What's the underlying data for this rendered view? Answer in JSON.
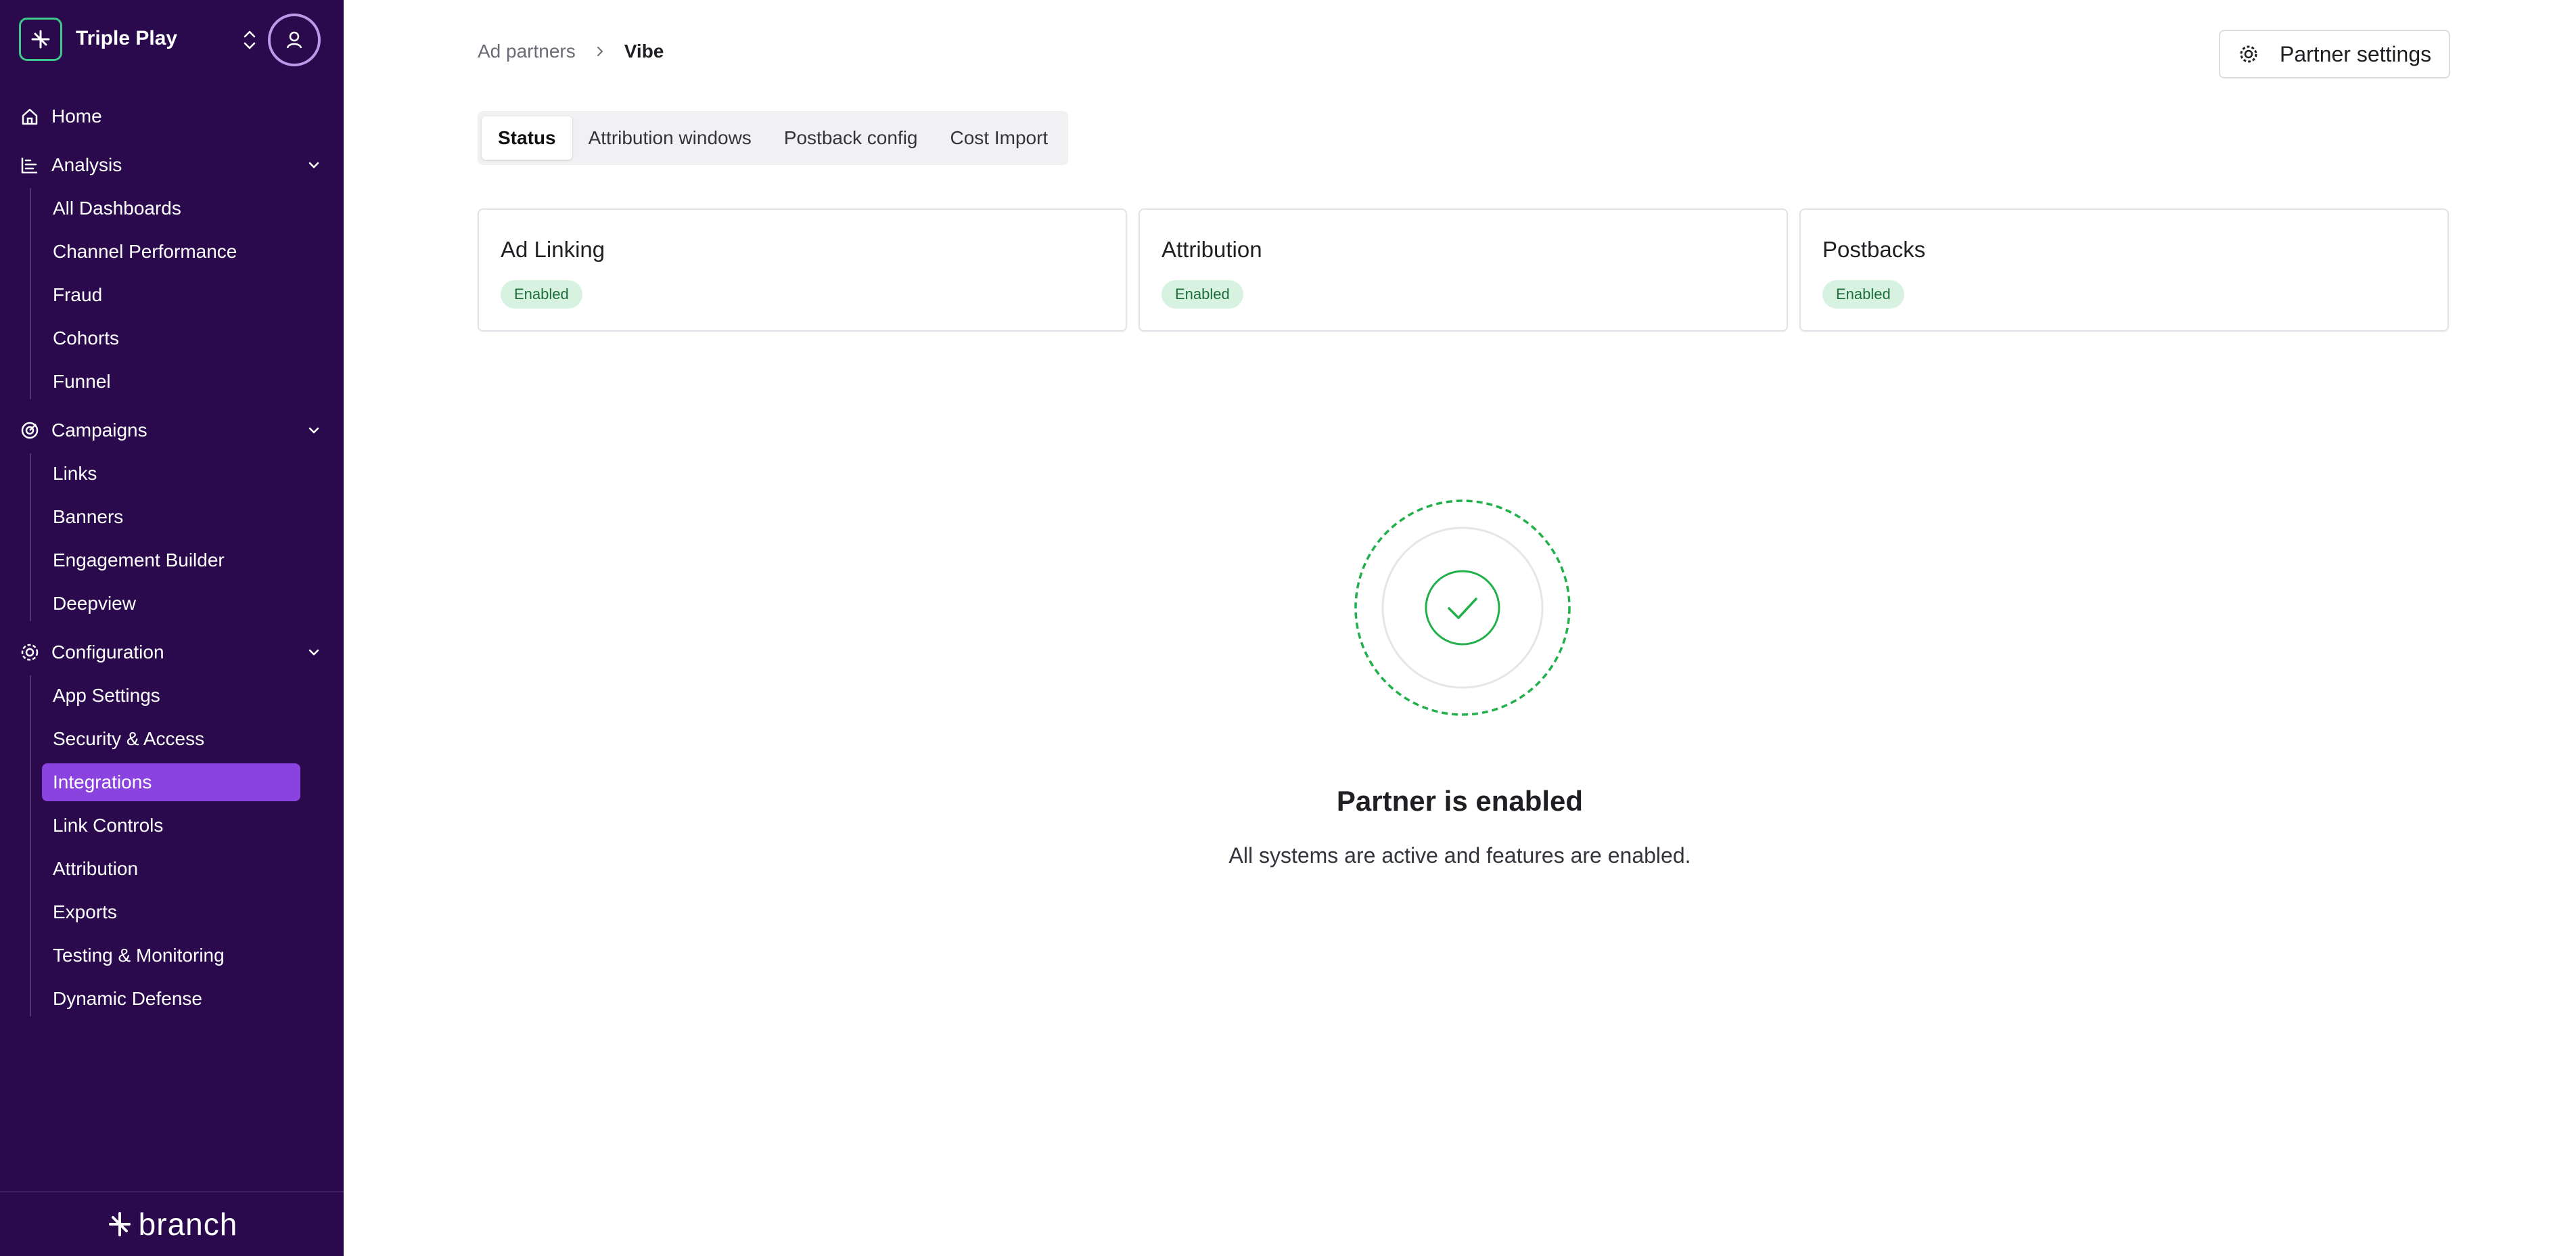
{
  "org": {
    "name": "Triple Play"
  },
  "sidebar": {
    "home": "Home",
    "analysis": {
      "label": "Analysis",
      "items": [
        "All Dashboards",
        "Channel Performance",
        "Fraud",
        "Cohorts",
        "Funnel"
      ]
    },
    "campaigns": {
      "label": "Campaigns",
      "items": [
        "Links",
        "Banners",
        "Engagement Builder",
        "Deepview"
      ]
    },
    "configuration": {
      "label": "Configuration",
      "items": [
        "App Settings",
        "Security & Access",
        "Integrations",
        "Link Controls",
        "Attribution",
        "Exports",
        "Testing & Monitoring",
        "Dynamic Defense"
      ],
      "active_item": "Integrations"
    },
    "brand": "branch"
  },
  "breadcrumb": {
    "parent": "Ad partners",
    "current": "Vibe"
  },
  "header": {
    "partner_settings": "Partner settings"
  },
  "tabs": [
    "Status",
    "Attribution windows",
    "Postback config",
    "Cost Import"
  ],
  "active_tab": "Status",
  "cards": [
    {
      "title": "Ad Linking",
      "status": "Enabled"
    },
    {
      "title": "Attribution",
      "status": "Enabled"
    },
    {
      "title": "Postbacks",
      "status": "Enabled"
    }
  ],
  "status": {
    "title": "Partner is enabled",
    "subtitle": "All systems are active and features are enabled."
  },
  "colors": {
    "sidebar_bg": "#2a0a4d",
    "active_item_bg": "#8b43e0",
    "success": "#22b04b",
    "badge_bg": "#d7f2e0"
  }
}
